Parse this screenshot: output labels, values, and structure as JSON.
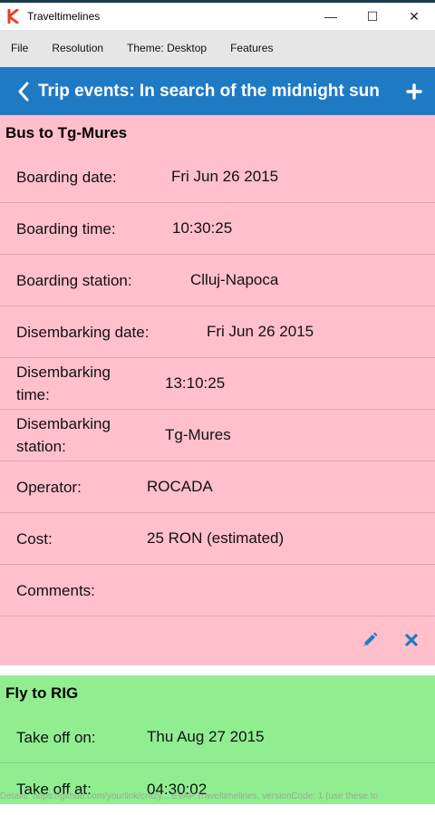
{
  "window": {
    "title": "Traveltimelines",
    "minimize_glyph": "—",
    "maximize_glyph": "☐",
    "close_glyph": "✕"
  },
  "menu": {
    "items": [
      "File",
      "Resolution",
      "Theme: Desktop",
      "Features"
    ]
  },
  "appbar": {
    "title": "Trip events: In search of the midnight sun",
    "back_icon": "chevron-left-icon",
    "add_icon": "plus-icon"
  },
  "colors": {
    "appbar": "#1f7ac4",
    "pink_card": "#ffc0cb",
    "green_card": "#90ee90",
    "action_icon": "#1f7ac4"
  },
  "events": [
    {
      "title": "Bus to Tg-Mures",
      "color": "pink",
      "rows": [
        {
          "label": "Boarding date:",
          "value": "Fri Jun 26 2015"
        },
        {
          "label": "Boarding time:",
          "value": "10:30:25"
        },
        {
          "label": "Boarding station:",
          "value": "Clluj-Napoca"
        },
        {
          "label": "Disembarking date:",
          "value": "Fri Jun 26 2015"
        },
        {
          "label": "Disembarking time:",
          "value": "13:10:25"
        },
        {
          "label": "Disembarking station:",
          "value": "Tg-Mures"
        },
        {
          "label": "Operator:",
          "value": "ROCADA"
        },
        {
          "label": "Cost:",
          "value": "25 RON (estimated)"
        },
        {
          "label": "Comments:",
          "value": ""
        }
      ],
      "actions": [
        "pencil-icon",
        "close-icon"
      ]
    },
    {
      "title": "Fly to RIG",
      "color": "green",
      "rows": [
        {
          "label": "Take off on:",
          "value": "Thu Aug 27 2015"
        },
        {
          "label": "Take off at:",
          "value": "04:30:02"
        }
      ]
    }
  ],
  "footer_note": "Details: https://github.com/yourlink/crazy... EVAP.Traveltimelines, versionCode: 1 (use these to"
}
